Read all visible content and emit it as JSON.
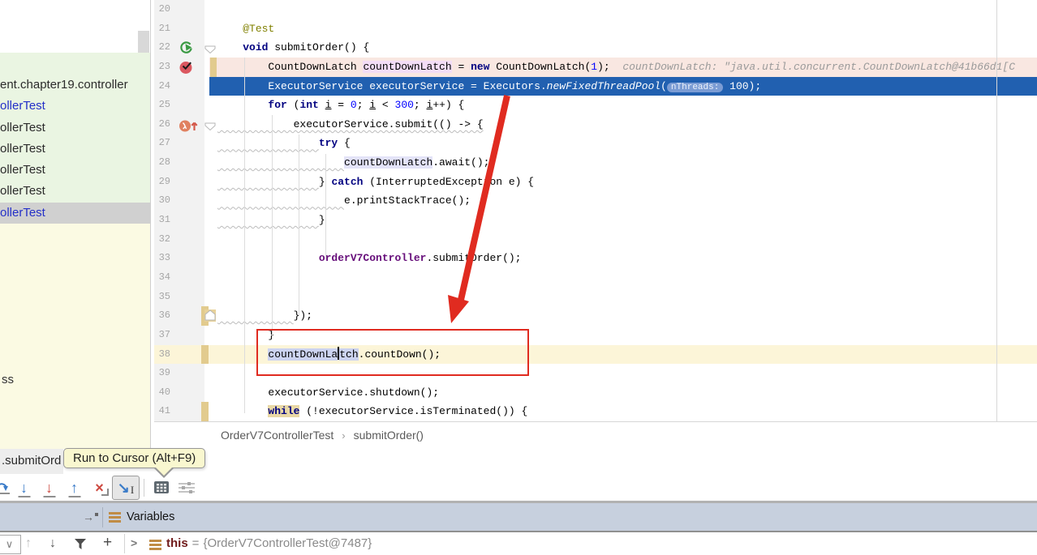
{
  "left_popup": {
    "items": [
      {
        "label": "ent.chapter19.controller"
      },
      {
        "label": "ollerTest",
        "style": "link"
      },
      {
        "label": "ollerTest"
      },
      {
        "label": "ollerTest"
      },
      {
        "label": "ollerTest"
      },
      {
        "label": "ollerTest"
      },
      {
        "label": "ollerTest",
        "style": "link",
        "selected": true
      }
    ],
    "doc_fragment": "ss"
  },
  "debug_tab": {
    "label": ".submitOrd"
  },
  "tooltip": {
    "text": "Run to Cursor (Alt+F9)"
  },
  "breadcrumb": {
    "class_name": "OrderV7ControllerTest",
    "separator": "›",
    "method": "submitOrder()"
  },
  "editor": {
    "lines": [
      {
        "n": "20",
        "s": []
      },
      {
        "n": "21",
        "s": [
          [
            "p",
            "    "
          ],
          [
            "a",
            "@Test"
          ]
        ]
      },
      {
        "n": "22",
        "ic": "run",
        "fd": "open",
        "s": [
          [
            "p",
            "    "
          ],
          [
            "k",
            "void"
          ],
          [
            "p",
            " submitOrder() {"
          ]
        ]
      },
      {
        "n": "23",
        "bg": "bp",
        "ic": "bp",
        "vc": "right",
        "s": [
          [
            "p",
            "        CountDownLatch "
          ],
          [
            "d",
            "countDownLatch"
          ],
          [
            "p",
            " = "
          ],
          [
            "k",
            "new"
          ],
          [
            "p",
            " CountDownLatch("
          ],
          [
            "n2",
            "1"
          ],
          [
            "p",
            ");  "
          ],
          [
            "h",
            "countDownLatch: \"java.util.concurrent.CountDownLatch@41b66d1[C"
          ]
        ]
      },
      {
        "n": "24",
        "bg": "exec",
        "s": [
          [
            "p",
            "        ExecutorService executorService = Executors."
          ],
          [
            "i",
            "newFixedThreadPool"
          ],
          [
            "p",
            "("
          ],
          [
            "chip",
            "nThreads:"
          ],
          [
            "p",
            " 100);"
          ]
        ]
      },
      {
        "n": "25",
        "s": [
          [
            "p",
            "        "
          ],
          [
            "k",
            "for"
          ],
          [
            "p",
            " ("
          ],
          [
            "k",
            "int"
          ],
          [
            "p",
            " "
          ],
          [
            "ul",
            "i"
          ],
          [
            "p",
            " = "
          ],
          [
            "n2",
            "0"
          ],
          [
            "p",
            "; "
          ],
          [
            "ul",
            "i"
          ],
          [
            "p",
            " < "
          ],
          [
            "n2",
            "300"
          ],
          [
            "p",
            "; "
          ],
          [
            "ul",
            "i"
          ],
          [
            "p",
            "++) {"
          ]
        ]
      },
      {
        "n": "26",
        "ic": "lambda",
        "fd": "open",
        "s": [
          [
            "w",
            "            executorService.submit(() -> {"
          ]
        ]
      },
      {
        "n": "27",
        "s": [
          [
            "w",
            "                "
          ],
          [
            "k",
            "try"
          ],
          [
            "p",
            " {"
          ]
        ]
      },
      {
        "n": "28",
        "s": [
          [
            "w",
            "                    "
          ],
          [
            "u",
            "countDownLatch"
          ],
          [
            "p",
            ".await();"
          ]
        ]
      },
      {
        "n": "29",
        "s": [
          [
            "w",
            "                "
          ],
          [
            "p",
            "} "
          ],
          [
            "k",
            "catch"
          ],
          [
            "p",
            " (InterruptedException e) {"
          ]
        ]
      },
      {
        "n": "30",
        "s": [
          [
            "w",
            "                    "
          ],
          [
            "p",
            "e.printStackTrace();"
          ]
        ]
      },
      {
        "n": "31",
        "s": [
          [
            "w",
            "                "
          ],
          [
            "p",
            "}"
          ]
        ]
      },
      {
        "n": "32",
        "s": []
      },
      {
        "n": "33",
        "s": [
          [
            "p",
            "                "
          ],
          [
            "f",
            "orderV7Controller"
          ],
          [
            "p",
            ".submitOrder();"
          ]
        ]
      },
      {
        "n": "34",
        "s": []
      },
      {
        "n": "35",
        "s": []
      },
      {
        "n": "36",
        "fd": "end",
        "vc": "left",
        "s": [
          [
            "w",
            "            "
          ],
          [
            "p",
            "});"
          ]
        ]
      },
      {
        "n": "37",
        "s": [
          [
            "p",
            "        }"
          ]
        ]
      },
      {
        "n": "38",
        "bg": "caret",
        "vc": "left",
        "s": [
          [
            "p",
            "        "
          ],
          [
            "c",
            "countDownLa"
          ],
          [
            "caret",
            ""
          ],
          [
            "c",
            "tch"
          ],
          [
            "p",
            ".countDown();"
          ]
        ]
      },
      {
        "n": "39",
        "s": []
      },
      {
        "n": "40",
        "s": [
          [
            "p",
            "        executorService.shutdown();"
          ]
        ]
      },
      {
        "n": "41",
        "vc": "left",
        "s": [
          [
            "p",
            "        "
          ],
          [
            "kh",
            "while"
          ],
          [
            "p",
            " (!executorService.isTerminated()) {"
          ]
        ]
      }
    ]
  },
  "debug_toolbar": {
    "buttons": [
      {
        "name": "step-over",
        "shape": "stepover",
        "partial": true
      },
      {
        "name": "step-into",
        "glyph": "↓",
        "color": "blue",
        "underline": true
      },
      {
        "name": "force-step-into",
        "glyph": "↓",
        "color": "red",
        "underline": true
      },
      {
        "name": "step-out",
        "glyph": "↑",
        "color": "blue",
        "underline": true
      },
      {
        "name": "drop-frame",
        "glyph": "×",
        "color": "red",
        "corner": true
      },
      {
        "name": "run-to-cursor",
        "glyph": "↘",
        "color": "blue",
        "beam": "I",
        "pressed": true
      },
      {
        "sep": true
      },
      {
        "name": "evaluate-expression",
        "shape": "calculator"
      },
      {
        "name": "layout-settings",
        "shape": "sliders",
        "disabled": true
      }
    ]
  },
  "variables_panel": {
    "header": "Variables",
    "pin_glyph": "→",
    "row": {
      "expander": ">",
      "name": "this",
      "equals": "=",
      "value": "{OrderV7ControllerTest@7487}"
    }
  },
  "frames_toolbar": {
    "combo_chevron": "∨",
    "nav_up": "↑",
    "nav_down": "↓",
    "add": "+"
  },
  "colors": {
    "execution_line": "#2160b0",
    "breakpoint_line": "#f9e7e1",
    "caret_line": "#fcf5d8",
    "annotation_red": "#e02b20",
    "param_hint_chip": "#7b9cd4",
    "popup_list_bg": "#eaf5e2",
    "doc_panel_bg": "#fbfae3",
    "variables_header_bg": "#c7d0de"
  }
}
